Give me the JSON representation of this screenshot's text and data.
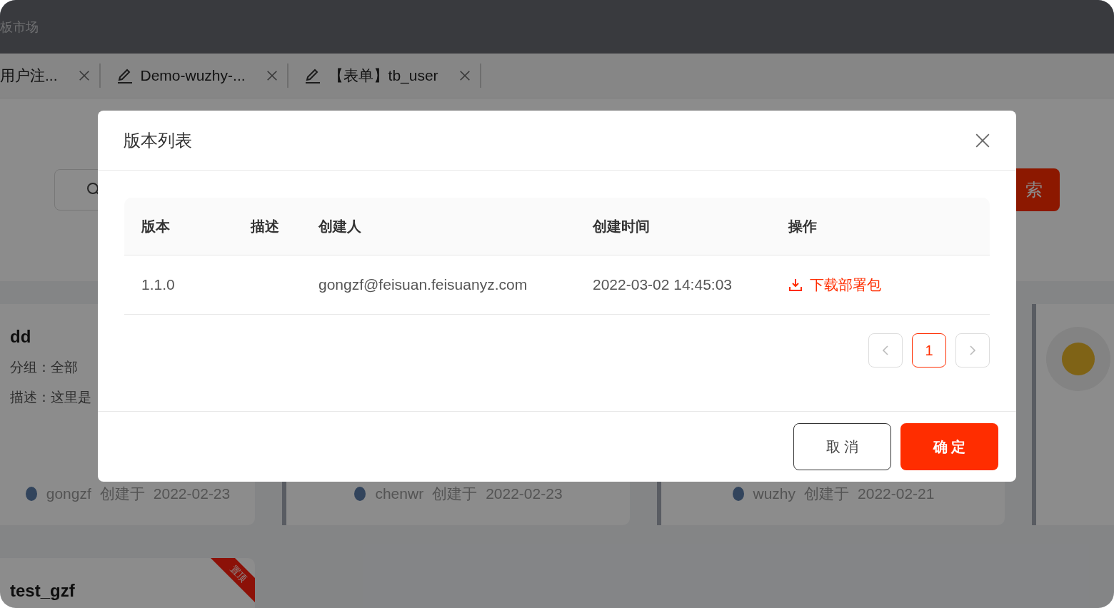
{
  "header": {
    "title": "板市场"
  },
  "tabs": [
    {
      "label": "用户注...",
      "edit_icon": false
    },
    {
      "label": "Demo-wuzhy-...",
      "edit_icon": true
    },
    {
      "label": "【表单】tb_user",
      "edit_icon": true
    }
  ],
  "search": {
    "button": "索"
  },
  "cards": [
    {
      "title": "dd",
      "group": "分组：全部",
      "description": "描述：这里是",
      "author": "gongzf",
      "created_label": "创建于",
      "date": "2022-02-23"
    },
    {
      "author": "chenwr",
      "created_label": "创建于",
      "date": "2022-02-23"
    },
    {
      "author": "wuzhy",
      "created_label": "创建于",
      "date": "2022-02-21"
    },
    {
      "photo": true
    }
  ],
  "cards_row_2": [
    {
      "title": "test_gzf",
      "ribbon": "置顶"
    }
  ],
  "modal": {
    "title": "版本列表",
    "columns": [
      "版本",
      "描述",
      "创建人",
      "创建时间",
      "操作"
    ],
    "rows": [
      {
        "version": "1.1.0",
        "creator": "gongzf@feisuan.feisuanyz.com",
        "created_at": "2022-03-02 14:45:03",
        "action": "下载部署包"
      }
    ],
    "pages": [
      {
        "label": "1",
        "selected": true
      }
    ],
    "cancel": "取 消",
    "confirm": "确 定"
  }
}
